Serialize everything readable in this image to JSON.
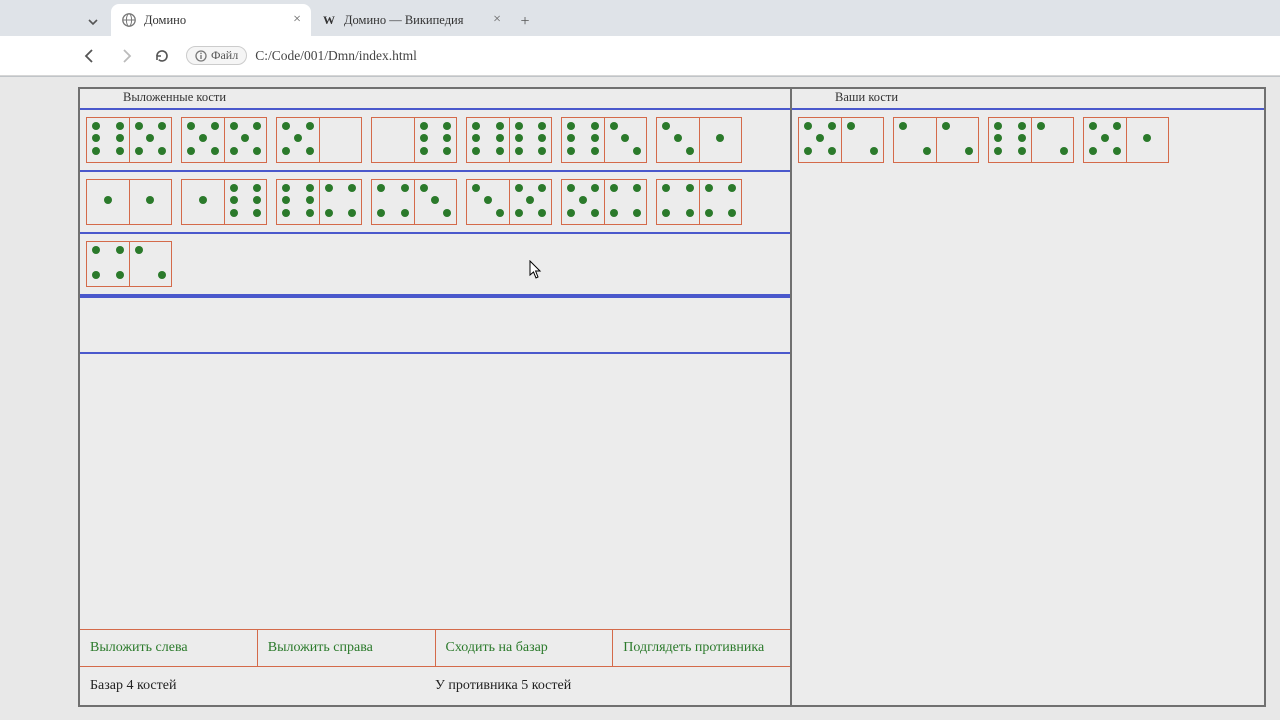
{
  "browser": {
    "tabs": [
      {
        "title": "Домино",
        "icon": "globe",
        "active": true
      },
      {
        "title": "Домино — Википедия",
        "icon": "W",
        "active": false
      }
    ],
    "file_badge": "Файл",
    "url": "C:/Code/001/Dmn/index.html"
  },
  "headers": {
    "played": "Выложенные кости",
    "hand": "Ваши кости"
  },
  "played_rows": [
    [
      [
        6,
        5
      ],
      [
        5,
        5
      ],
      [
        5,
        0
      ],
      [
        0,
        6
      ],
      [
        6,
        6
      ],
      [
        6,
        3
      ],
      [
        3,
        1
      ]
    ],
    [
      [
        1,
        1
      ],
      [
        1,
        6
      ],
      [
        6,
        4
      ],
      [
        4,
        3
      ],
      [
        3,
        5
      ],
      [
        5,
        4
      ],
      [
        4,
        4
      ]
    ],
    [
      [
        4,
        2
      ]
    ]
  ],
  "hand": [
    [
      5,
      2
    ],
    [
      2,
      2
    ],
    [
      6,
      2
    ],
    [
      5,
      1
    ]
  ],
  "actions": {
    "place_left": "Выложить слева",
    "place_right": "Выложить справа",
    "go_bazaar": "Сходить на базар",
    "peek_opponent": "Подглядеть противника"
  },
  "status": {
    "bazaar": "Базар 4 костей",
    "opponent": "У противника 5 костей"
  }
}
